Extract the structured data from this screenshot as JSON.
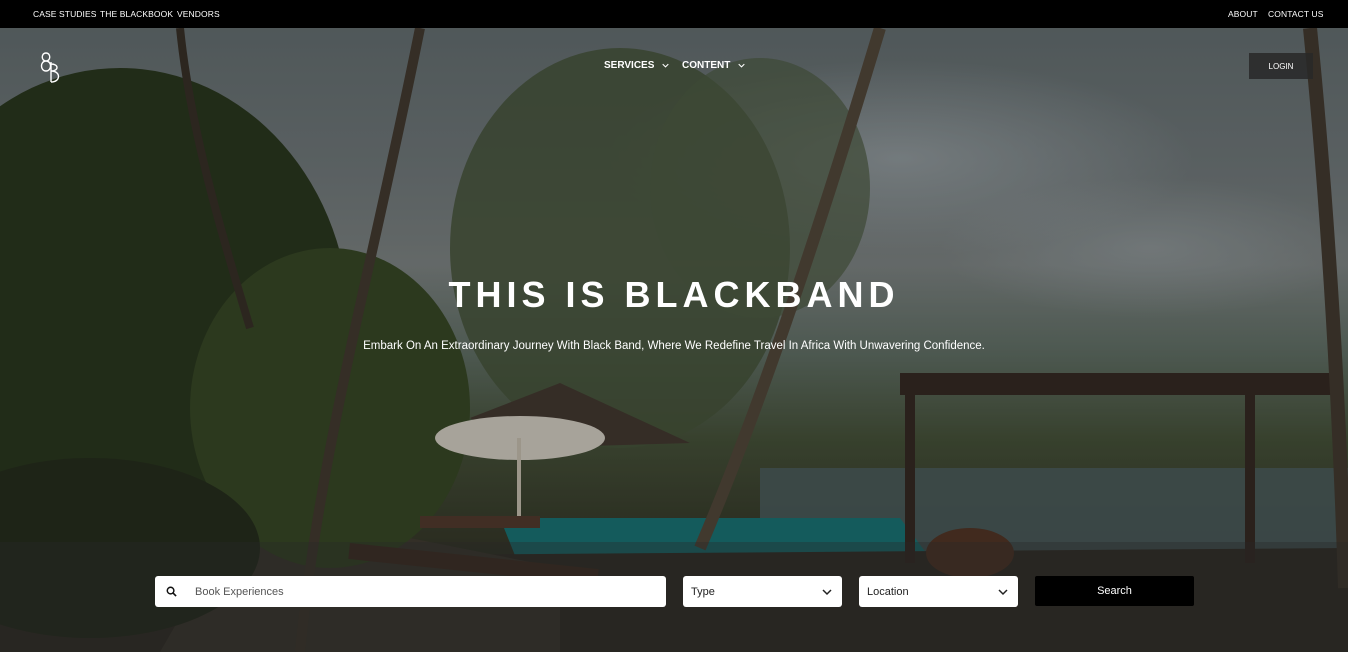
{
  "topbar": {
    "left_links": [
      "CASE STUDIES",
      "THE BLACKBOOK",
      "VENDORS"
    ],
    "right_links": [
      "ABOUT",
      "CONTACT US"
    ]
  },
  "header": {
    "logo_icon": "bb-monogram-logo",
    "nav": [
      {
        "label": "SERVICES",
        "icon": "chevron-down-icon"
      },
      {
        "label": "CONTENT",
        "icon": "chevron-down-icon"
      }
    ],
    "login_label": "LOGIN"
  },
  "hero": {
    "title": "THIS IS BLACKBAND",
    "subtitle": "Embark On An Extraordinary Journey With Black Band, Where We Redefine Travel In Africa With Unwavering Confidence."
  },
  "search": {
    "placeholder": "Book Experiences",
    "search_icon": "search-icon",
    "type_label": "Type",
    "location_label": "Location",
    "button_label": "Search"
  },
  "colors": {
    "topbar_bg": "#000000",
    "button_bg": "#000000",
    "login_bg": "#282828",
    "text": "#ffffff"
  }
}
